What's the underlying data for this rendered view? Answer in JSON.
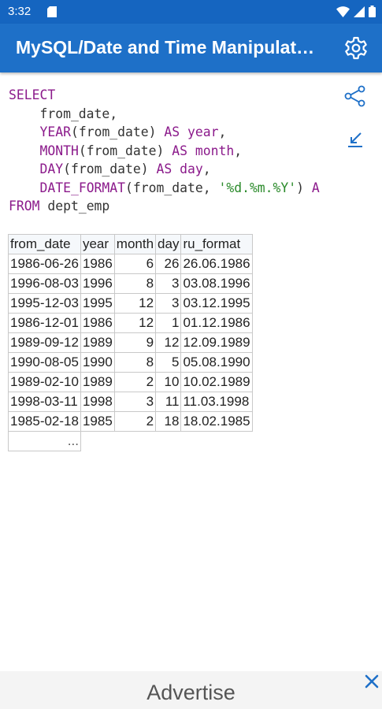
{
  "status_bar": {
    "time": "3:32"
  },
  "app_bar": {
    "title": "MySQL/Date and Time Manipulat…"
  },
  "code": {
    "lines": [
      [
        {
          "t": "SELECT",
          "c": "kw"
        }
      ],
      [
        {
          "t": "    from_date,",
          "c": "plain"
        }
      ],
      [
        {
          "t": "    ",
          "c": "plain"
        },
        {
          "t": "YEAR",
          "c": "kw"
        },
        {
          "t": "(from_date) ",
          "c": "plain"
        },
        {
          "t": "AS year",
          "c": "kw"
        },
        {
          "t": ",",
          "c": "plain"
        }
      ],
      [
        {
          "t": "    ",
          "c": "plain"
        },
        {
          "t": "MONTH",
          "c": "kw"
        },
        {
          "t": "(from_date) ",
          "c": "plain"
        },
        {
          "t": "AS month",
          "c": "kw"
        },
        {
          "t": ",",
          "c": "plain"
        }
      ],
      [
        {
          "t": "    ",
          "c": "plain"
        },
        {
          "t": "DAY",
          "c": "kw"
        },
        {
          "t": "(from_date) ",
          "c": "plain"
        },
        {
          "t": "AS day",
          "c": "kw"
        },
        {
          "t": ",",
          "c": "plain"
        }
      ],
      [
        {
          "t": "    ",
          "c": "plain"
        },
        {
          "t": "DATE_FORMAT",
          "c": "kw"
        },
        {
          "t": "(from_date, ",
          "c": "plain"
        },
        {
          "t": "'%d.%m.%Y'",
          "c": "str"
        },
        {
          "t": ") ",
          "c": "plain"
        },
        {
          "t": "A",
          "c": "kw"
        }
      ],
      [
        {
          "t": "FROM",
          "c": "kw"
        },
        {
          "t": " dept_emp",
          "c": "plain"
        }
      ]
    ]
  },
  "table": {
    "columns": [
      "from_date",
      "year",
      "month",
      "day",
      "ru_format"
    ],
    "rows": [
      [
        "1986-06-26",
        "1986",
        "6",
        "26",
        "26.06.1986"
      ],
      [
        "1996-08-03",
        "1996",
        "8",
        "3",
        "03.08.1996"
      ],
      [
        "1995-12-03",
        "1995",
        "12",
        "3",
        "03.12.1995"
      ],
      [
        "1986-12-01",
        "1986",
        "12",
        "1",
        "01.12.1986"
      ],
      [
        "1989-09-12",
        "1989",
        "9",
        "12",
        "12.09.1989"
      ],
      [
        "1990-08-05",
        "1990",
        "8",
        "5",
        "05.08.1990"
      ],
      [
        "1989-02-10",
        "1989",
        "2",
        "10",
        "10.02.1989"
      ],
      [
        "1998-03-11",
        "1998",
        "3",
        "11",
        "11.03.1998"
      ],
      [
        "1985-02-18",
        "1985",
        "2",
        "18",
        "18.02.1985"
      ]
    ],
    "more": "..."
  },
  "ad": {
    "label": "Advertise"
  },
  "colors": {
    "app_bar": "#1e70c8",
    "status_bar": "#1565c0",
    "keyword": "#8b1a8b",
    "string": "#2a8a2a",
    "icon_accent": "#1e70c8"
  },
  "icons": [
    "sd-card-icon",
    "wifi-icon",
    "signal-icon",
    "battery-icon",
    "settings-gear-icon",
    "share-icon",
    "wrap-text-icon",
    "close-icon"
  ]
}
